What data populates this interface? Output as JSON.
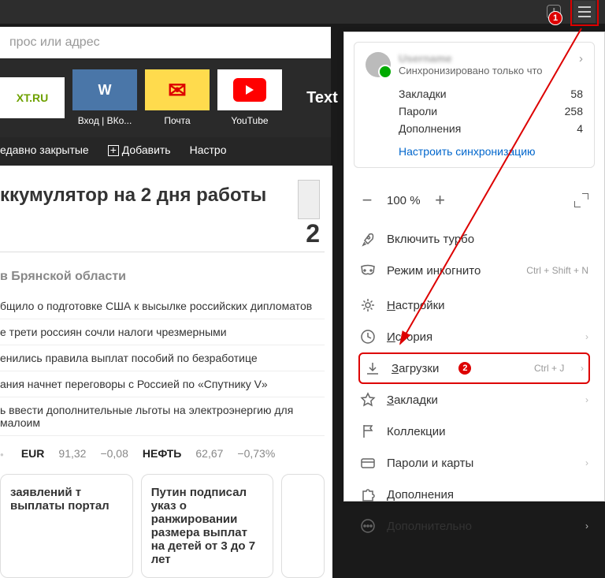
{
  "browser_top": {
    "annotation_1": "1"
  },
  "address_placeholder": "прос или адрес",
  "bookmarks": [
    {
      "icon_text": "XT.RU",
      "label": ""
    },
    {
      "icon_text": "W",
      "label": "Вход | ВКо..."
    },
    {
      "icon_text": "✉",
      "label": "Почта"
    },
    {
      "icon_text": "",
      "label": "YouTube"
    },
    {
      "icon_text": "Text",
      "label": ""
    }
  ],
  "toolbar": {
    "recently": "едавно закрытые",
    "add": "Добавить",
    "settings": "Настро"
  },
  "headline": "ккумулятор на 2 дня работы",
  "big_char": "2",
  "region": "в Брянской области",
  "news": [
    "бщило о подготовке США к высылке российских дипломатов",
    "е трети россиян сочли налоги чрезмерными",
    "енились правила выплат пособий по безработице",
    "ания начнет переговоры с Россией по «Спутнику V»",
    "ь ввести дополнительные льготы на электроэнергию для малоим"
  ],
  "ticker": {
    "eur_label": "EUR",
    "eur_val": "91,32",
    "eur_delta": "−0,08",
    "oil_label": "НЕФТЬ",
    "oil_val": "62,67",
    "oil_pct": "−0,73%"
  },
  "cards": [
    "заявлений т выплаты портал",
    "Путин подписал указ о ранжировании размера выплат на детей от 3 до 7 лет",
    ""
  ],
  "panel": {
    "sync": {
      "name": "Username",
      "subtitle": "Синхронизировано только что",
      "items": [
        {
          "label": "Закладки",
          "count": 58
        },
        {
          "label": "Пароли",
          "count": 258
        },
        {
          "label": "Дополнения",
          "count": 4
        }
      ],
      "link": "Настроить синхронизацию"
    },
    "zoom": {
      "minus": "−",
      "value": "100 %",
      "plus": "+"
    },
    "menu": {
      "turbo": "Включить турбо",
      "incognito": "Режим инкогнито",
      "incognito_shortcut": "Ctrl + Shift + N",
      "settings": "Настройки",
      "history": "История",
      "downloads": "Загрузки",
      "downloads_shortcut": "Ctrl + J",
      "downloads_badge": "2",
      "bookmarks": "Закладки",
      "collections": "Коллекции",
      "passwords": "Пароли и карты",
      "addons": "Дополнения",
      "more": "Дополнительно"
    }
  }
}
